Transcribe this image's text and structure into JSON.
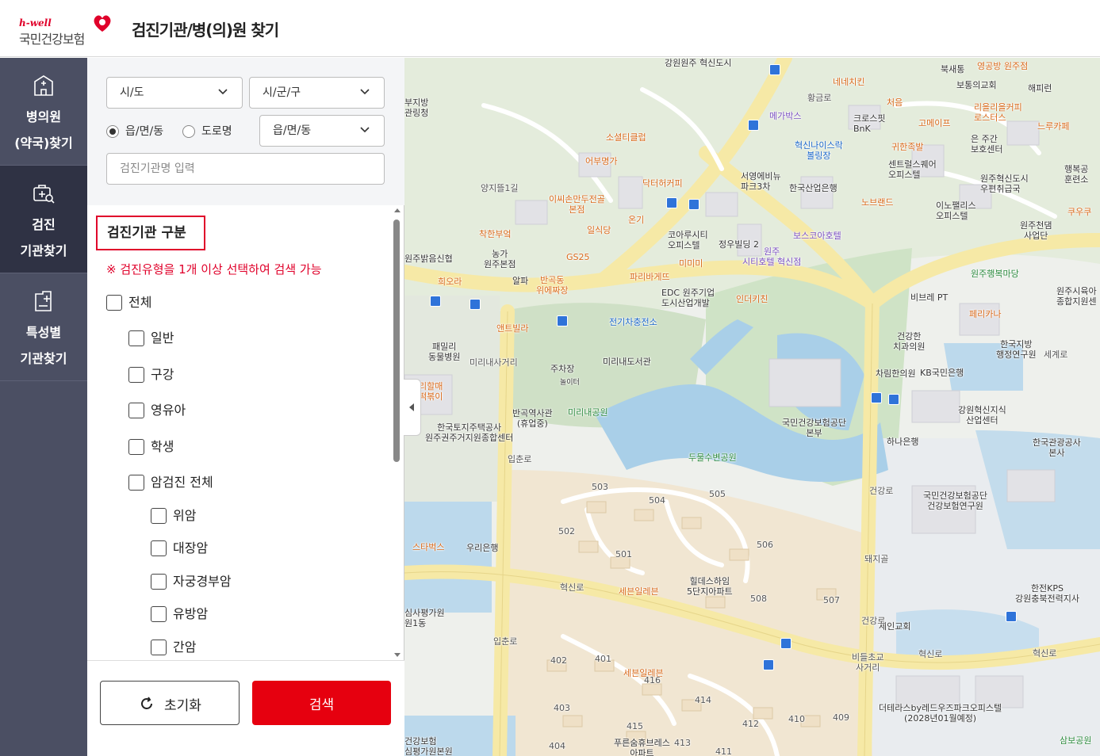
{
  "header": {
    "logo_tagline": "h-well",
    "logo_name": "국민건강보험",
    "title": "검진기관/병(의)원 찾기"
  },
  "sidebar": {
    "items": [
      {
        "label": "병의원\n(약국)찾기",
        "icon": "hospital-building-icon",
        "active": false
      },
      {
        "label": "검진\n기관찾기",
        "icon": "medical-kit-search-icon",
        "active": true
      },
      {
        "label": "특성별\n기관찾기",
        "icon": "medical-report-icon",
        "active": false
      }
    ]
  },
  "filters": {
    "sido": "시/도",
    "sigungu": "시/군/구",
    "radio_eupmyeondong": "읍/면/동",
    "radio_road": "도로명",
    "address_select": "읍/면/동",
    "name_placeholder": "검진기관명 입력"
  },
  "section": {
    "title": "검진기관 구분",
    "notice": "※ 검진유형을 1개 이상 선택하여 검색 가능"
  },
  "checkboxes": [
    {
      "label": "전체",
      "level": 0,
      "checked": false
    },
    {
      "label": "일반",
      "level": 1,
      "checked": false
    },
    {
      "label": "구강",
      "level": 1,
      "checked": false
    },
    {
      "label": "영유아",
      "level": 1,
      "checked": false
    },
    {
      "label": "학생",
      "level": 1,
      "checked": false
    },
    {
      "label": "암검진 전체",
      "level": 1,
      "checked": false
    },
    {
      "label": "위암",
      "level": 2,
      "checked": false
    },
    {
      "label": "대장암",
      "level": 2,
      "checked": false
    },
    {
      "label": "자궁경부암",
      "level": 2,
      "checked": false
    },
    {
      "label": "유방암",
      "level": 2,
      "checked": false
    },
    {
      "label": "간암",
      "level": 2,
      "checked": false
    }
  ],
  "buttons": {
    "reset": "초기화",
    "search": "검색"
  },
  "colors": {
    "accent_red": "#e6000f",
    "sidebar_bg": "#4b4f63",
    "sidebar_active": "#2f3244"
  },
  "map": {
    "pois": [
      {
        "text": "강원원주\n혁신도시",
        "color": "gray"
      },
      {
        "text": "북새통",
        "color": "gray"
      },
      {
        "text": "영공방 원주점",
        "color": "orange"
      },
      {
        "text": "보통의교회",
        "color": "gray"
      },
      {
        "text": "해피런",
        "color": "gray"
      },
      {
        "text": "부지방\n관링청",
        "color": "gray"
      },
      {
        "text": "네네치킨",
        "color": "orange"
      },
      {
        "text": "처음",
        "color": "orange"
      },
      {
        "text": "리을리을커피\n로스터스",
        "color": "orange"
      },
      {
        "text": "느루카페",
        "color": "orange"
      },
      {
        "text": "메가박스",
        "color": "purple"
      },
      {
        "text": "크로스핏\nBnK",
        "color": "gray"
      },
      {
        "text": "고메이프",
        "color": "orange"
      },
      {
        "text": "혁신나이스락\n볼링장",
        "color": "blue"
      },
      {
        "text": "소셜티클럽",
        "color": "orange"
      },
      {
        "text": "귀한족발",
        "color": "orange"
      },
      {
        "text": "은 주간\n보호센터",
        "color": "gray"
      },
      {
        "text": "어부명가",
        "color": "orange"
      },
      {
        "text": "센트럴스퀘어\n오피스텔",
        "color": "gray"
      },
      {
        "text": "행복공\n훈련소",
        "color": "gray"
      },
      {
        "text": "닥터허커피",
        "color": "orange"
      },
      {
        "text": "서영에비뉴\n파크3차",
        "color": "gray"
      },
      {
        "text": "한국산업은행",
        "color": "gray"
      },
      {
        "text": "원주혁신도시\n우편취급국",
        "color": "gray"
      },
      {
        "text": "이씨손만두전골\n본점",
        "color": "orange"
      },
      {
        "text": "노브랜드",
        "color": "orange"
      },
      {
        "text": "이노팰리스\n오피스텔",
        "color": "gray"
      },
      {
        "text": "쿠우쿠",
        "color": "orange"
      },
      {
        "text": "일식당",
        "color": "orange"
      },
      {
        "text": "온기",
        "color": "orange"
      },
      {
        "text": "원주천댐\n사업단",
        "color": "gray"
      },
      {
        "text": "착한부엌",
        "color": "orange"
      },
      {
        "text": "GS25",
        "color": "orange"
      },
      {
        "text": "코아루시티\n오피스텔",
        "color": "gray"
      },
      {
        "text": "정우빌딩 2",
        "color": "gray"
      },
      {
        "text": "보스코아호텔",
        "color": "purple"
      },
      {
        "text": "농가\n원주본점",
        "color": "gray"
      },
      {
        "text": "원주밝음신협",
        "color": "gray"
      },
      {
        "text": "원주\n시티호텔 혁신점",
        "color": "purple"
      },
      {
        "text": "미미미",
        "color": "orange"
      },
      {
        "text": "원주행복마당",
        "color": "green"
      },
      {
        "text": "희오라",
        "color": "orange"
      },
      {
        "text": "알파",
        "color": "gray"
      },
      {
        "text": "반곡동\n위에짜장",
        "color": "orange"
      },
      {
        "text": "파리바게뜨",
        "color": "orange"
      },
      {
        "text": "EDC 원주기업\n도시산업개발",
        "color": "gray"
      },
      {
        "text": "인더키친",
        "color": "orange"
      },
      {
        "text": "원주시육아\n종합지원센",
        "color": "gray"
      },
      {
        "text": "비브레 PT",
        "color": "gray"
      },
      {
        "text": "페리카나",
        "color": "orange"
      },
      {
        "text": "앤트빌라",
        "color": "orange"
      },
      {
        "text": "전기차충전소",
        "color": "blue"
      },
      {
        "text": "건강한\n치과의원",
        "color": "gray"
      },
      {
        "text": "한국지방\n행정연구원",
        "color": "gray"
      },
      {
        "text": "패밀리\n동물병원",
        "color": "gray"
      },
      {
        "text": "미리내사거리",
        "color": "road"
      },
      {
        "text": "주차장",
        "color": "gray"
      },
      {
        "text": "미리내도서관",
        "color": "gray"
      },
      {
        "text": "차림한의원",
        "color": "gray"
      },
      {
        "text": "KB국민은행",
        "color": "gray"
      },
      {
        "text": "놀이터",
        "color": "gray"
      },
      {
        "text": "리할매\n떡볶이",
        "color": "orange"
      },
      {
        "text": "미리내공원",
        "color": "green"
      },
      {
        "text": "반곡역사관\n(휴업중)",
        "color": "gray"
      },
      {
        "text": "강원혁신지식\n산업센터",
        "color": "gray"
      },
      {
        "text": "국민건강보험공단\n본부",
        "color": "gray"
      },
      {
        "text": "한국토지주택공사\n원주권주거지원종합센터",
        "color": "gray"
      },
      {
        "text": "하나은행",
        "color": "gray"
      },
      {
        "text": "한국관광공사\n본사",
        "color": "gray"
      },
      {
        "text": "두물수변공원",
        "color": "green"
      },
      {
        "text": "국민건강보험공단\n건강보험연구원",
        "color": "gray"
      },
      {
        "text": "스타벅스",
        "color": "orange"
      },
      {
        "text": "우리은행",
        "color": "gray"
      },
      {
        "text": "힐데스하임\n5단지아파트",
        "color": "gray"
      },
      {
        "text": "세븐일레븐",
        "color": "orange"
      },
      {
        "text": "한전KPS\n강원충북전력지사",
        "color": "gray"
      },
      {
        "text": "심사평가원\n원1동",
        "color": "gray"
      },
      {
        "text": "세인교회",
        "color": "gray"
      },
      {
        "text": "비들초교\n사거리",
        "color": "road"
      },
      {
        "text": "세븐일레븐",
        "color": "orange"
      },
      {
        "text": "더테라스by레드우즈파크오피스텔\n(2028년01월예정)",
        "color": "gray"
      },
      {
        "text": "푸른숨휴브레스\n아파트",
        "color": "gray"
      },
      {
        "text": "건강보험\n심평가원본원",
        "color": "gray"
      },
      {
        "text": "삼보공원",
        "color": "green"
      }
    ],
    "roads": [
      "혁신로",
      "혁신로",
      "혁신로",
      "입춘로",
      "입춘로",
      "건강로",
      "건강로",
      "돼지골",
      "세계로",
      "황금로",
      "양지뜰1길"
    ],
    "blocks": [
      "503",
      "504",
      "505",
      "502",
      "501",
      "506",
      "508",
      "507",
      "402",
      "401",
      "416",
      "403",
      "414",
      "415",
      "412",
      "410",
      "409",
      "404",
      "413",
      "411"
    ]
  }
}
